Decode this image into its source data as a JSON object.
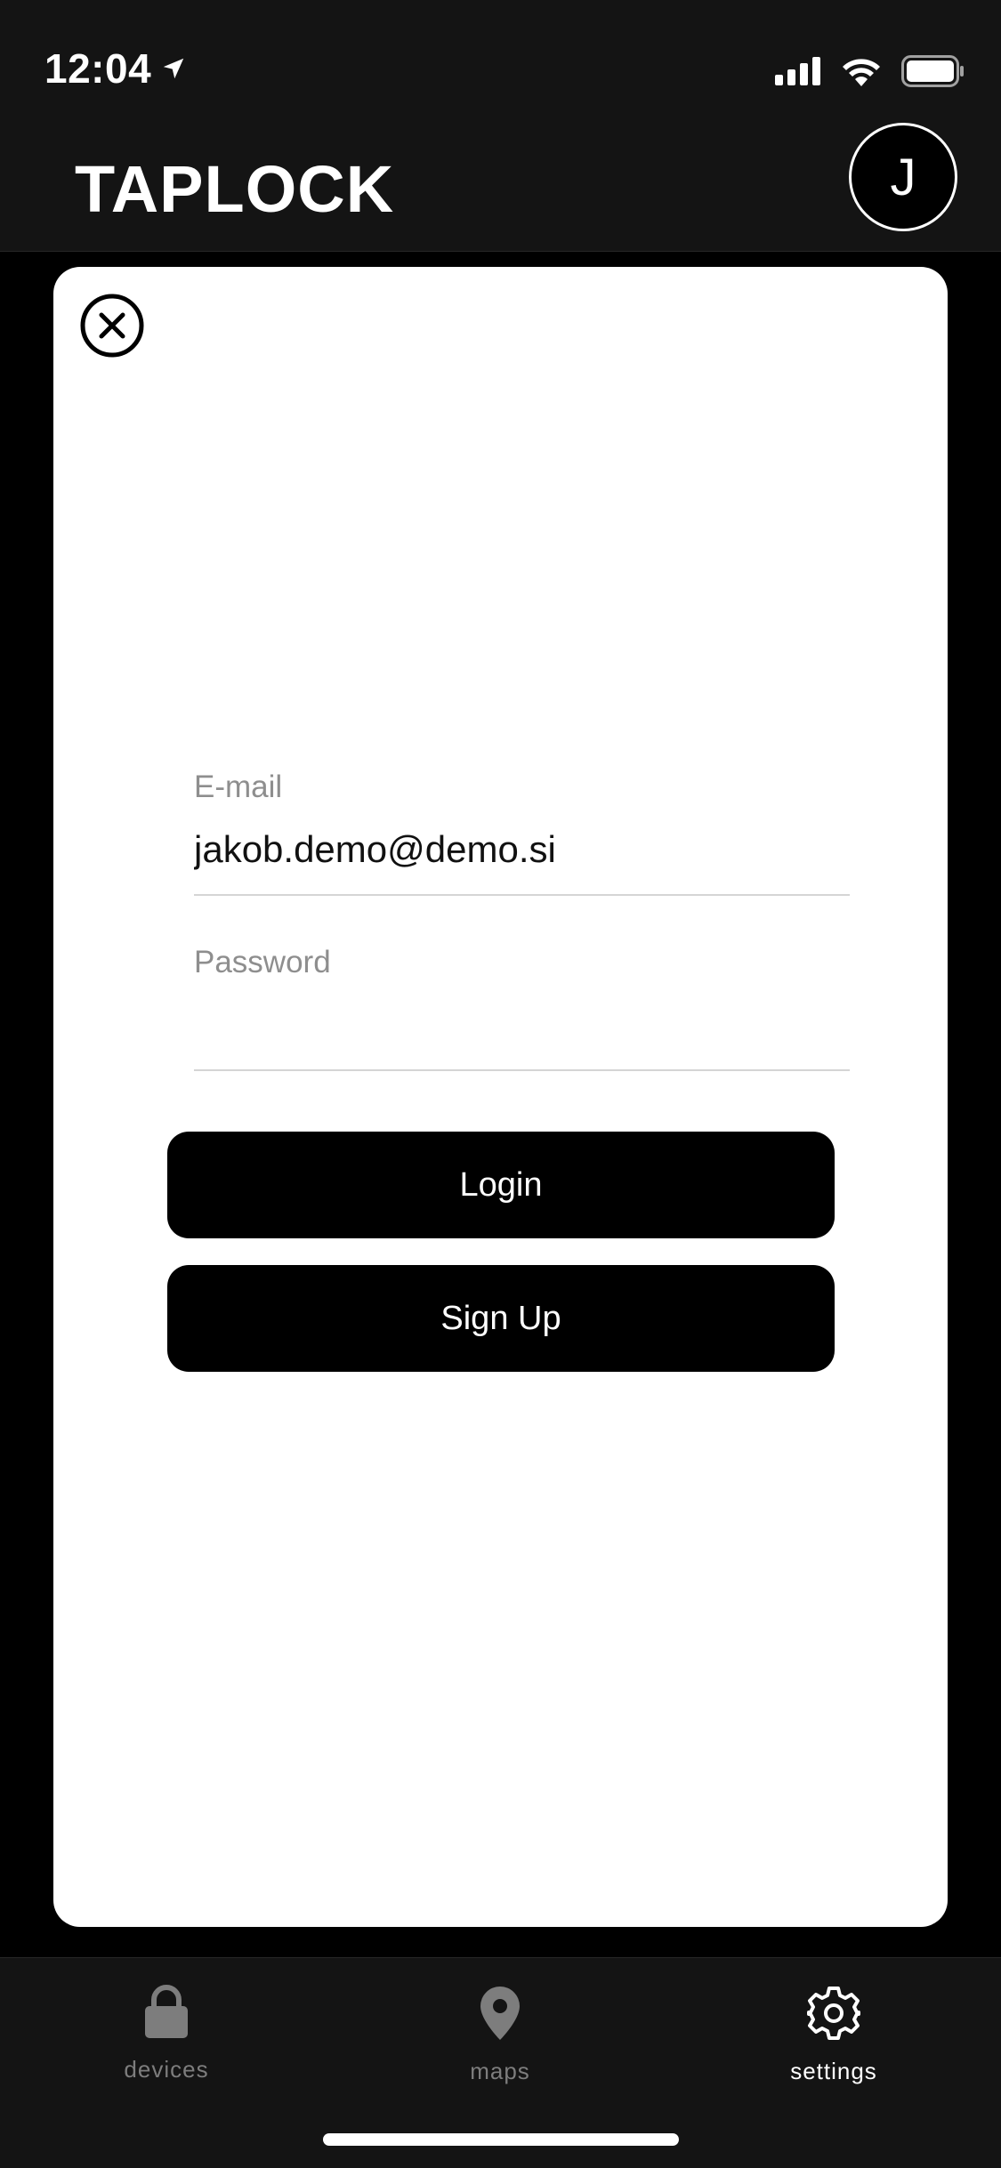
{
  "status_bar": {
    "time": "12:04"
  },
  "header": {
    "title": "TAPLOCK",
    "avatar_initial": "J"
  },
  "login_form": {
    "email_label": "E-mail",
    "email_value": "jakob.demo@demo.si",
    "password_label": "Password",
    "password_value": "",
    "login_button": "Login",
    "signup_button": "Sign Up"
  },
  "tab_bar": {
    "tabs": [
      {
        "label": "devices",
        "icon": "lock-icon",
        "active": false
      },
      {
        "label": "maps",
        "icon": "map-pin-icon",
        "active": false
      },
      {
        "label": "settings",
        "icon": "gear-icon",
        "active": true
      }
    ]
  },
  "colors": {
    "background": "#000000",
    "bar": "#141414",
    "card": "#ffffff",
    "inactive_tab": "#7d7d7d"
  }
}
